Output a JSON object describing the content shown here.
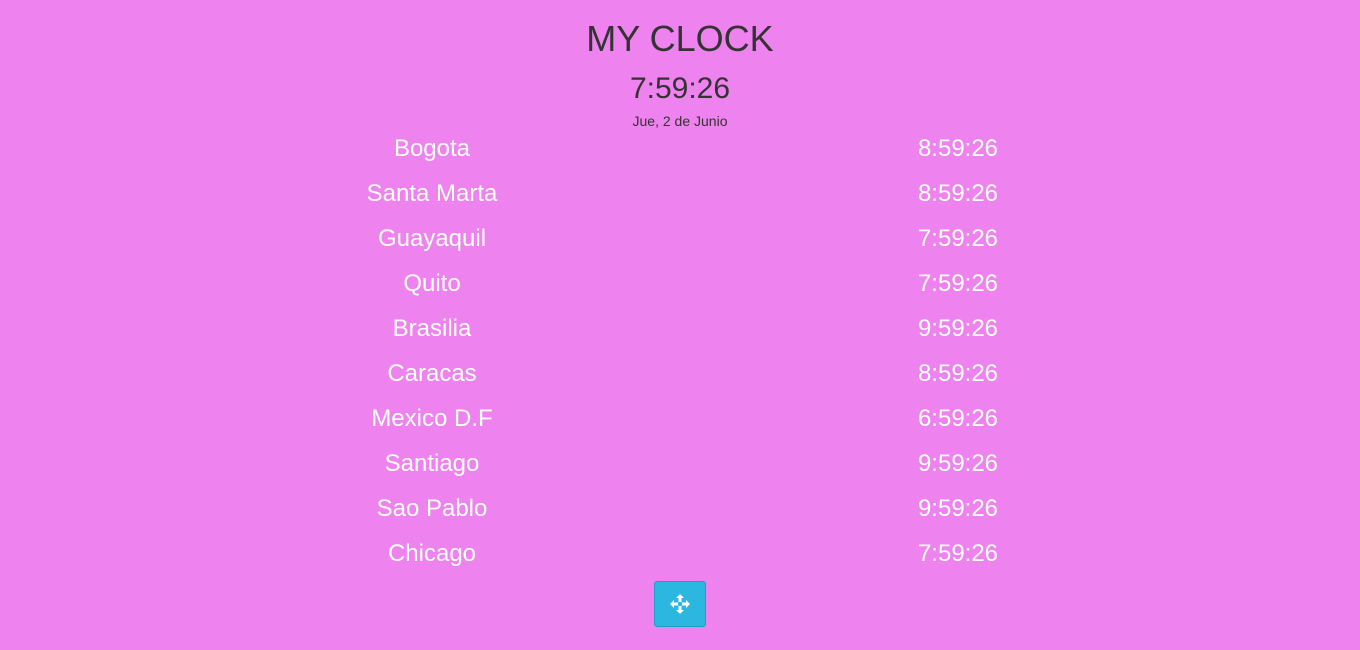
{
  "header": {
    "title": "MY CLOCK",
    "current_time": "7:59:26",
    "current_date": "Jue, 2 de Junio"
  },
  "cities": [
    {
      "name": "Bogota",
      "time": "8:59:26"
    },
    {
      "name": "Santa Marta",
      "time": "8:59:26"
    },
    {
      "name": "Guayaquil",
      "time": "7:59:26"
    },
    {
      "name": "Quito",
      "time": "7:59:26"
    },
    {
      "name": "Brasilia",
      "time": "9:59:26"
    },
    {
      "name": "Caracas",
      "time": "8:59:26"
    },
    {
      "name": "Mexico D.F",
      "time": "6:59:26"
    },
    {
      "name": "Santiago",
      "time": "9:59:26"
    },
    {
      "name": "Sao Pablo",
      "time": "9:59:26"
    },
    {
      "name": "Chicago",
      "time": "7:59:26"
    }
  ],
  "action_button": {
    "icon": "move-arrows-icon"
  },
  "colors": {
    "background": "#ee82ee",
    "header_text": "#333333",
    "city_text": "#ffffff",
    "button": "#2bb7e0"
  }
}
